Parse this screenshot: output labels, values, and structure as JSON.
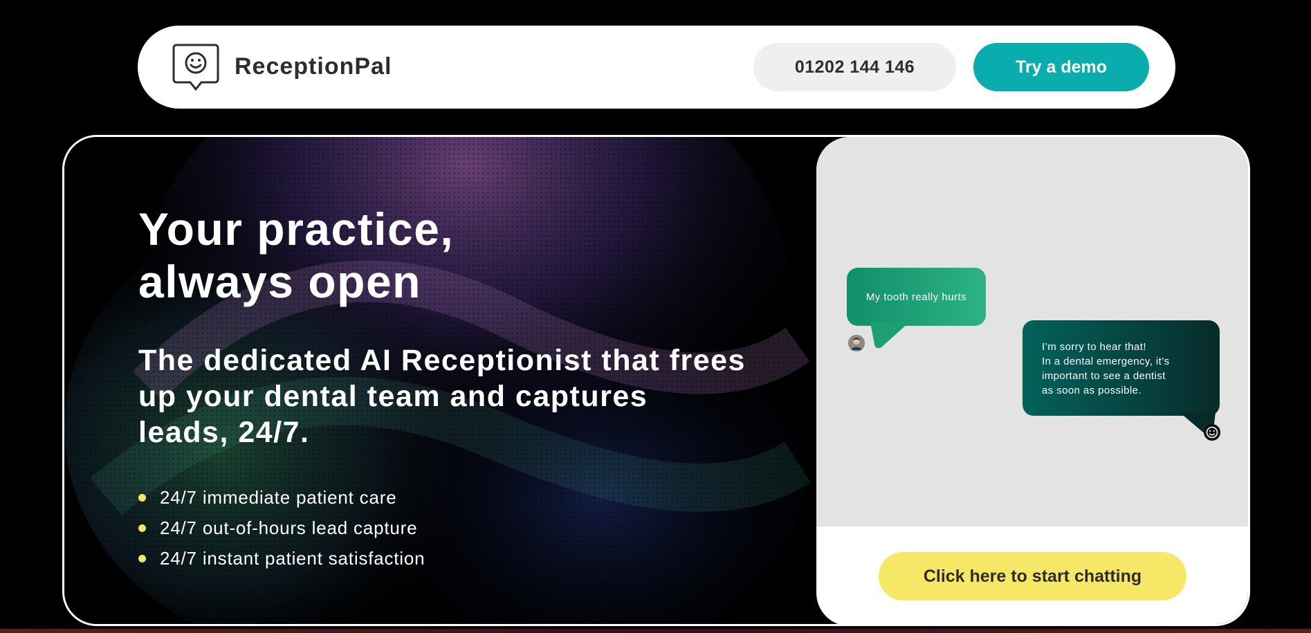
{
  "header": {
    "brand_name": "ReceptionPal",
    "logo_icon": "smiley-chat-bubble-icon",
    "phone_label": "01202 144 146",
    "demo_label": "Try a demo"
  },
  "hero": {
    "headline_line1": "Your practice,",
    "headline_line2": "always open",
    "subheadline": "The dedicated AI Receptionist that frees up your dental team and captures leads, 24/7.",
    "features": [
      "24/7 immediate patient care",
      "24/7 out-of-hours lead capture",
      "24/7 instant patient satisfaction"
    ]
  },
  "chat": {
    "user_message": "My tooth really hurts",
    "bot_message_lines": [
      "I’m sorry to hear that!",
      "In a dental emergency, it’s",
      "important to see a dentist",
      "as soon as possible."
    ],
    "start_chat_label": "Click here to start chatting"
  },
  "colors": {
    "brand_teal": "#0aadae",
    "cta_yellow": "#f6e866",
    "bullet_yellow": "#f6e566",
    "user_bubble_green": "#2db383",
    "bot_bubble_dark_teal": "#063f3c"
  }
}
